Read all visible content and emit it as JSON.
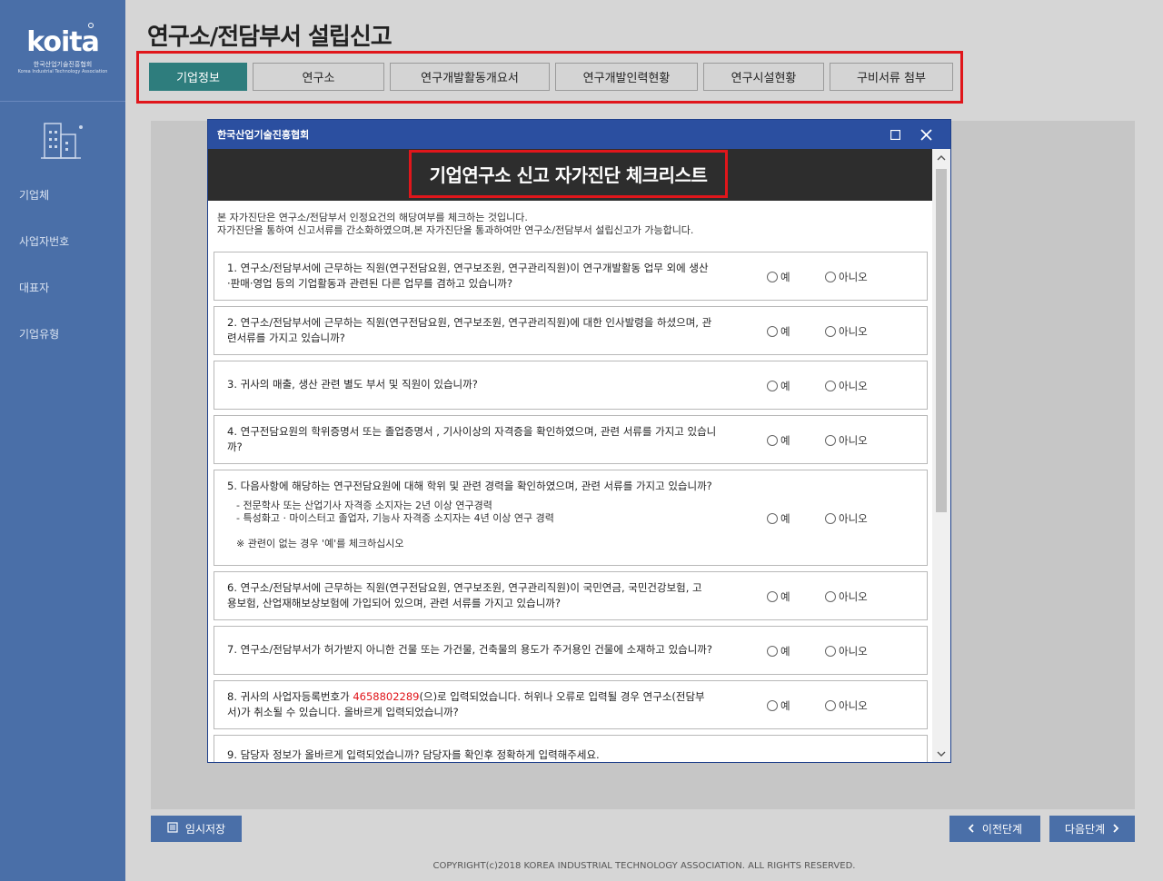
{
  "sidebar": {
    "logo_text": "koita",
    "logo_sub": "한국산업기술진흥협회",
    "logo_sub_en": "Korea Industrial Technology Association",
    "items": [
      {
        "label": "기업체"
      },
      {
        "label": "사업자번호"
      },
      {
        "label": "대표자"
      },
      {
        "label": "기업유형"
      }
    ]
  },
  "header": {
    "title": "연구소/전담부서 설립신고"
  },
  "tabs": [
    {
      "label": "기업정보",
      "active": true
    },
    {
      "label": "연구소"
    },
    {
      "label": "연구개발활동개요서"
    },
    {
      "label": "연구개발인력현황"
    },
    {
      "label": "연구시설현황"
    },
    {
      "label": "구비서류 첨부"
    }
  ],
  "modal": {
    "window_title": "한국산업기술진흥협회",
    "checklist_title": "기업연구소 신고 자가진단 체크리스트",
    "intro_line1": "본 자가진단은 연구소/전담부서 인정요건의 해당여부를 체크하는 것입니다.",
    "intro_line2": "자가진단을 통하여 신고서류를 간소화하였으며,본 자가진단을 통과하여만 연구소/전담부서 설립신고가 가능합니다.",
    "yes_label": "예",
    "no_label": "아니오",
    "questions": [
      {
        "line1": "1. 연구소/전담부서에 근무하는 직원(연구전담요원, 연구보조원, 연구관리직원)이 연구개발활동 업무 외에 생산",
        "line2": "·판매·영업 등의 기업활동과 관련된 다른 업무를 겸하고 있습니까?"
      },
      {
        "line1": "2. 연구소/전담부서에 근무하는 직원(연구전담요원, 연구보조원, 연구관리직원)에 대한 인사발령을 하셨으며, 관",
        "line2": "련서류를 가지고 있습니까?"
      },
      {
        "line1": "3. 귀사의 매출, 생산 관련 별도 부서 및 직원이 있습니까?",
        "line2": ""
      },
      {
        "line1": "4. 연구전담요원의 학위증명서 또는 졸업증명서 , 기사이상의 자격증을 확인하였으며, 관련 서류를 가지고 있습니",
        "line2": "까?"
      },
      {
        "line1": "5. 다음사항에 해당하는 연구전담요원에 대해 학위 및 관련 경력을 확인하였으며, 관련 서류를 가지고 있습니까?",
        "sub1": "- 전문학사 또는 산업기사 자격증 소지자는 2년 이상 연구경력",
        "sub2": "- 특성화고 · 마이스터고 졸업자, 기능사 자격증 소지자는 4년 이상 연구 경력",
        "note": "※ 관련이 없는 경우 '예'를 체크하십시오"
      },
      {
        "line1": "6. 연구소/전담부서에 근무하는 직원(연구전담요원, 연구보조원, 연구관리직원)이 국민연금, 국민건강보험, 고",
        "line2": "용보험, 산업재해보상보험에 가입되어 있으며, 관련 서류를 가지고 있습니까?"
      },
      {
        "line1": "7. 연구소/전담부서가 허가받지 아니한 건물 또는 가건물, 건축물의 용도가 주거용인 건물에 소재하고 있습니까?",
        "line2": ""
      },
      {
        "line1_pre": "8. 귀사의 사업자등록번호가 ",
        "biz_no": "4658802289",
        "line1_post": "(으)로 입력되었습니다. 허위나 오류로 입력될 경우 연구소(전담부",
        "line2": "서)가 취소될 수 있습니다. 올바르게 입력되었습니까?"
      },
      {
        "line1": "9. 담당자 정보가 올바르게 입력되었습니까? 담당자를 확인후 정확하게 입력해주세요.",
        "line2": ""
      }
    ]
  },
  "buttons": {
    "save": "임시저장",
    "prev": "이전단계",
    "next": "다음단계"
  },
  "footer": "COPYRIGHT(c)2018 KOREA INDUSTRIAL TECHNOLOGY ASSOCIATION. ALL RIGHTS RESERVED.",
  "colors": {
    "sidebar": "#4a6fa8",
    "active_tab": "#2e7d7d",
    "highlight": "#e0161b",
    "modal_bar": "#2b4fa0"
  }
}
